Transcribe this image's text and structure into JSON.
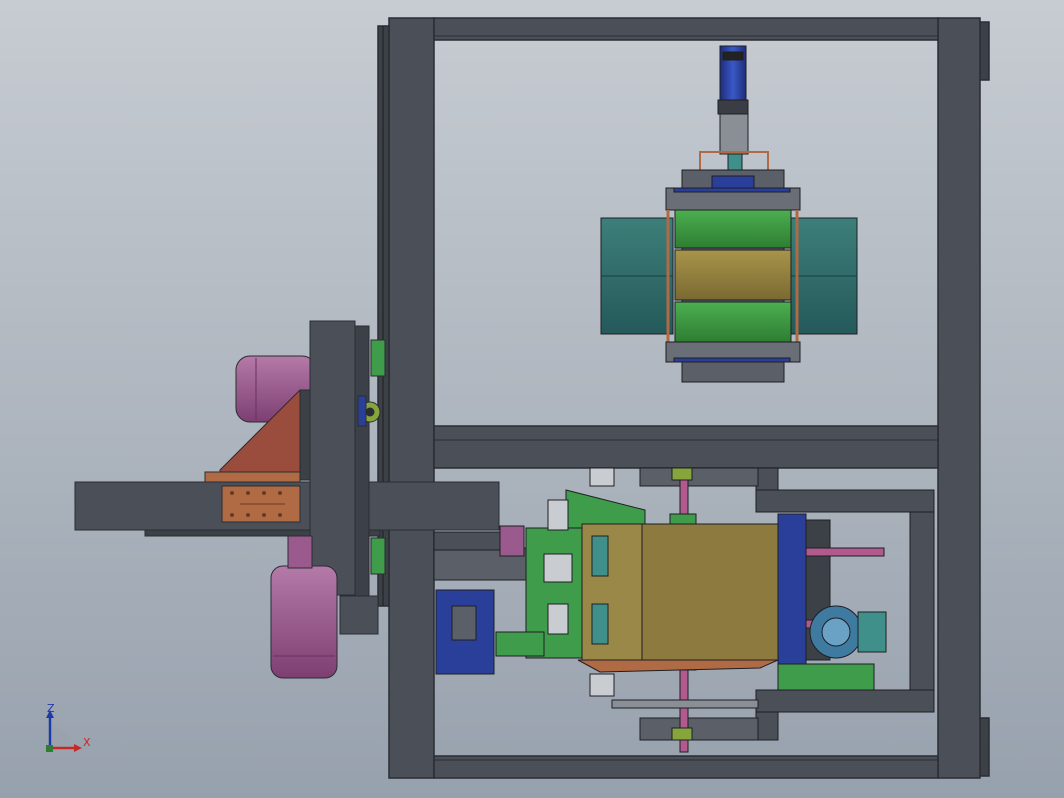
{
  "viewport": {
    "background_top": "#c7ccd2",
    "background_bottom": "#97a1ad"
  },
  "colors": {
    "frame": "#4b5058",
    "frame_edge": "#2a2d33",
    "frame_inner": "#3c4047",
    "motor_purple": "#9a5a8e",
    "motor_blue": "#2a3f9a",
    "plate_green": "#3f9c4a",
    "plate_olive": "#8c7a3e",
    "plate_teal": "#2f6f6a",
    "bracket_brown": "#b06a44",
    "bracket_red": "#9a4d3c",
    "gear_green": "#86a63c",
    "axis_x": "#c62828",
    "axis_y": "#2e7d32",
    "axis_z": "#1e3aa8"
  },
  "triad": {
    "z_label": "Z",
    "x_label": "X",
    "icon": "coordinate-triad-icon"
  }
}
